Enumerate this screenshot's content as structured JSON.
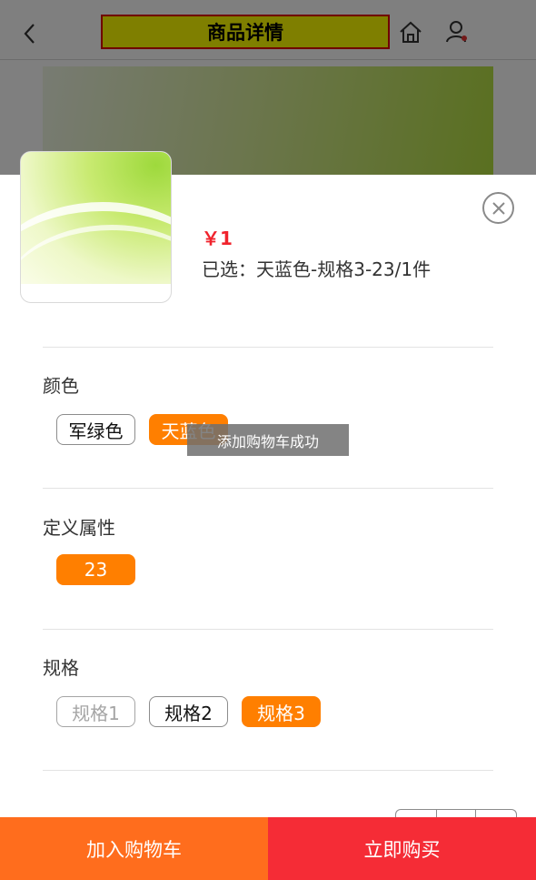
{
  "header": {
    "title": "商品详情",
    "back_icon": "chevron-left-icon",
    "home_icon": "home-icon",
    "user_icon": "user-icon"
  },
  "sheet": {
    "price": "￥1",
    "selected_text": "已选：天蓝色-规格3-23/1件",
    "close_icon": "close-circle-icon",
    "sections": [
      {
        "label": "颜色",
        "options": [
          {
            "label": "军绿色",
            "state": "normal"
          },
          {
            "label": "天蓝色",
            "state": "active"
          }
        ]
      },
      {
        "label": "定义属性",
        "options": [
          {
            "label": "23",
            "state": "active"
          }
        ]
      },
      {
        "label": "规格",
        "options": [
          {
            "label": "规格1",
            "state": "disabled"
          },
          {
            "label": "规格2",
            "state": "normal"
          },
          {
            "label": "规格3",
            "state": "active"
          }
        ]
      }
    ]
  },
  "toast": "添加购物车成功",
  "bottom_bar": {
    "add_to_cart": "加入购物车",
    "buy_now": "立即购买"
  },
  "colors": {
    "accent_orange": "#ff7f00",
    "cart_orange": "#ff6d1d",
    "buy_red": "#f52c36",
    "price_red": "#f0232c"
  }
}
